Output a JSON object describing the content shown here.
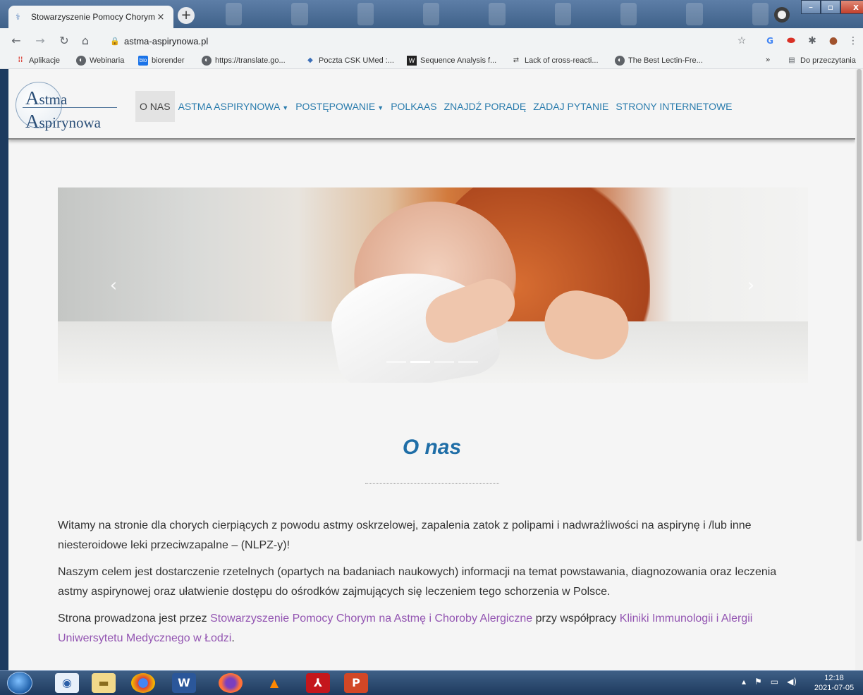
{
  "browser": {
    "tab_title": "Stowarzyszenie Pomocy Chorym",
    "tab_close": "×",
    "new_tab": "+",
    "url": "astma-aspirynowa.pl"
  },
  "bookmarks": [
    {
      "label": "Aplikacje",
      "icon": "apps-grid-icon"
    },
    {
      "label": "Webinaria",
      "icon": "globe-icon"
    },
    {
      "label": "biorender",
      "icon": "biorender-icon"
    },
    {
      "label": "https://translate.go...",
      "icon": "globe-icon"
    },
    {
      "label": "Poczta CSK UMed :...",
      "icon": "mail-icon"
    },
    {
      "label": "Sequence Analysis f...",
      "icon": "w-icon"
    },
    {
      "label": "Lack of cross-reacti...",
      "icon": "link-icon"
    },
    {
      "label": "The Best Lectin-Fre...",
      "icon": "globe-icon"
    }
  ],
  "bookmarks_overflow": "»",
  "reading_list": "Do przeczytania",
  "site": {
    "logo_line1_initial": "A",
    "logo_line1_rest": "stma",
    "logo_line2_initial": "A",
    "logo_line2_rest": "spirynowa",
    "nav": [
      {
        "label": "O NAS",
        "active": true,
        "dropdown": false
      },
      {
        "label": "ASTMA ASPIRYNOWA",
        "active": false,
        "dropdown": true
      },
      {
        "label": "POSTĘPOWANIE",
        "active": false,
        "dropdown": true
      },
      {
        "label": "POLKAAS",
        "active": false,
        "dropdown": false
      },
      {
        "label": "ZNAJDŹ PORADĘ",
        "active": false,
        "dropdown": false
      },
      {
        "label": "ZADAJ PYTANIE",
        "active": false,
        "dropdown": false
      },
      {
        "label": "STRONY INTERNETOWE",
        "active": false,
        "dropdown": false
      }
    ],
    "carousel": {
      "slides": 4,
      "active_index": 1,
      "prev": "‹",
      "next": "›"
    },
    "section_title": "O nas",
    "paragraphs": {
      "p1": "Witamy na stronie dla chorych cierpiących z powodu astmy oskrzelowej, zapalenia zatok z polipami i nadwrażliwości na aspirynę i /lub inne niesteroidowe leki przeciwzapalne – (NLPZ-y)!",
      "p2": "Naszym celem jest dostarczenie rzetelnych (opartych na badaniach naukowych) informacji na temat powstawania, diagnozowania oraz leczenia astmy aspirynowej oraz ułatwienie dostępu do ośrodków zajmujących się leczeniem tego schorzenia w Polsce.",
      "p3_before": "Strona prowadzona jest przez ",
      "p3_link1": "Stowarzyszenie Pomocy Chorym na Astmę i Choroby Alergiczne",
      "p3_middle": " przy współpracy ",
      "p3_link2": "Kliniki Immunologii i Alergii Uniwersytetu Medycznego w Łodzi",
      "p3_after": "."
    },
    "colors": {
      "link": "#2a7cad",
      "title": "#1f6ea7",
      "visited_link": "#9355b2"
    }
  },
  "taskbar": {
    "apps": [
      "start-orb",
      "thunderbird",
      "file-explorer",
      "chrome",
      "word",
      "firefox",
      "vlc",
      "acrobat",
      "powerpoint"
    ],
    "time": "12:18",
    "date": "2021-07-05"
  }
}
